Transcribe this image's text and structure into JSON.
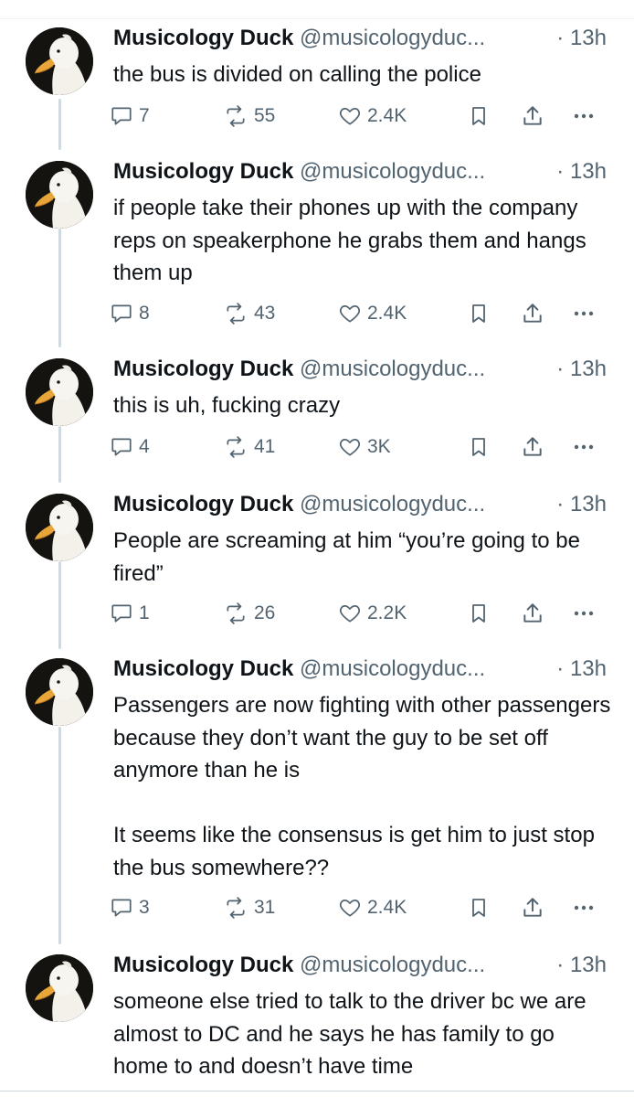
{
  "colors": {
    "text": "#0f1419",
    "muted": "#536471",
    "thread_line": "#cfd9de"
  },
  "icons": {
    "reply": "reply-icon",
    "retweet": "retweet-icon",
    "like": "heart-icon",
    "bookmark": "bookmark-icon",
    "share": "share-icon",
    "more": "more-icon"
  },
  "tweets": [
    {
      "name": "Musicology Duck",
      "handle": "@musicologyduc...",
      "dot": "·",
      "time": "13h",
      "text": "the bus is divided on calling the police",
      "replies": "7",
      "retweets": "55",
      "likes": "2.4K"
    },
    {
      "name": "Musicology Duck",
      "handle": "@musicologyduc...",
      "dot": "·",
      "time": "13h",
      "text": "if people take their phones up with the company reps on speakerphone he grabs them and hangs them up",
      "replies": "8",
      "retweets": "43",
      "likes": "2.4K"
    },
    {
      "name": "Musicology Duck",
      "handle": "@musicologyduc...",
      "dot": "·",
      "time": "13h",
      "text": "this is uh, fucking crazy",
      "replies": "4",
      "retweets": "41",
      "likes": "3K"
    },
    {
      "name": "Musicology Duck",
      "handle": "@musicologyduc...",
      "dot": "·",
      "time": "13h",
      "text": "People are screaming at him “you’re going to be fired”",
      "replies": "1",
      "retweets": "26",
      "likes": "2.2K"
    },
    {
      "name": "Musicology Duck",
      "handle": "@musicologyduc...",
      "dot": "·",
      "time": "13h",
      "text": "Passengers are now fighting with other passengers because they don’t want the guy to be set off anymore than he is\n\nIt seems like the consensus is get him to just stop the bus somewhere??",
      "replies": "3",
      "retweets": "31",
      "likes": "2.4K"
    },
    {
      "name": "Musicology Duck",
      "handle": "@musicologyduc...",
      "dot": "·",
      "time": "13h",
      "text": "someone else tried to talk to the driver bc we are almost to DC and he says he has family to go home to and doesn’t have time"
    }
  ]
}
